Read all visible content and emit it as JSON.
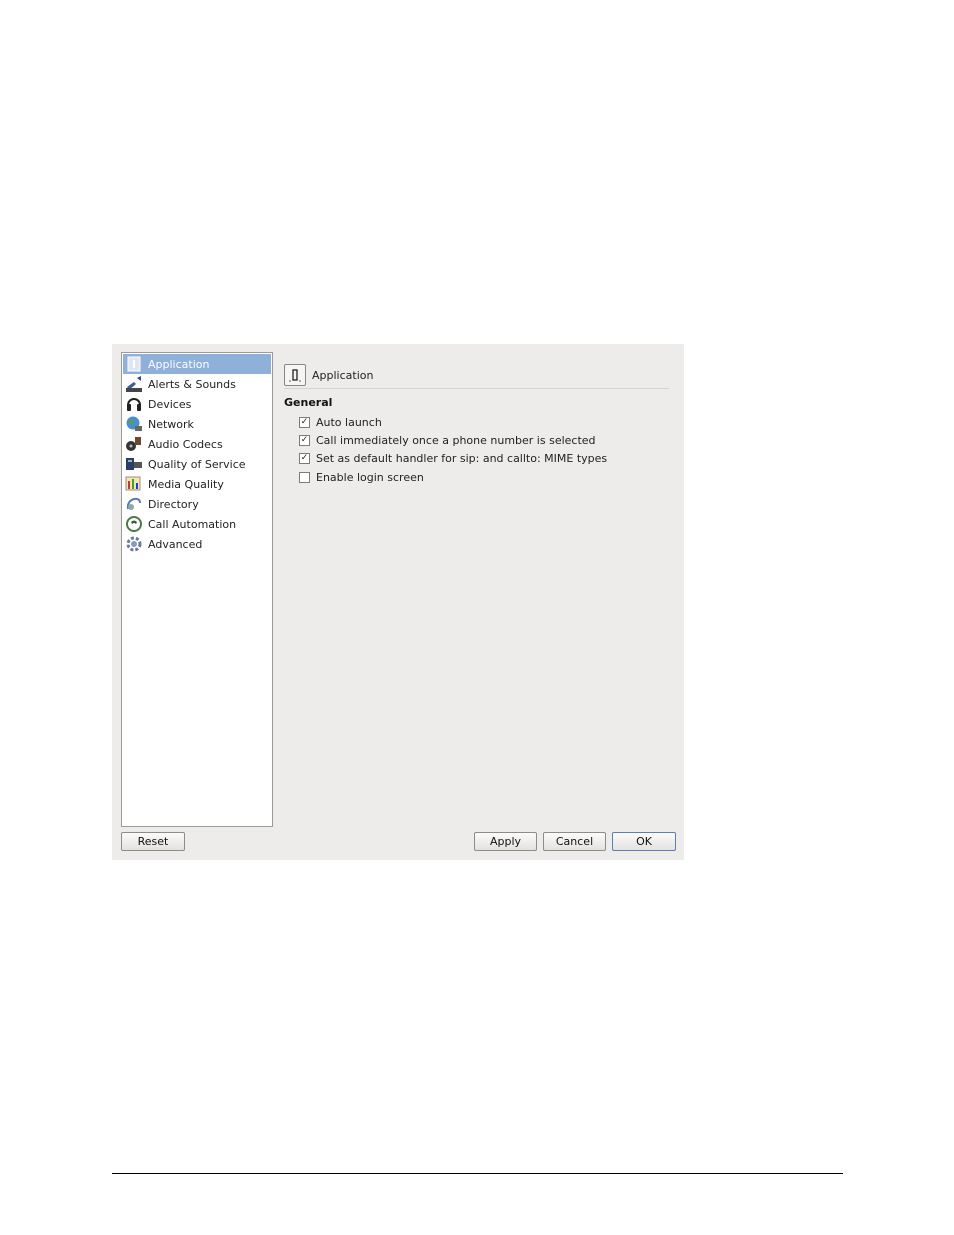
{
  "sidebar": {
    "items": [
      {
        "label": "Application",
        "icon": "application-icon",
        "selected": true
      },
      {
        "label": "Alerts & Sounds",
        "icon": "speaker-icon",
        "selected": false
      },
      {
        "label": "Devices",
        "icon": "headset-icon",
        "selected": false
      },
      {
        "label": "Network",
        "icon": "globe-icon",
        "selected": false
      },
      {
        "label": "Audio Codecs",
        "icon": "audio-codecs-icon",
        "selected": false
      },
      {
        "label": "Quality of Service",
        "icon": "quality-of-service-icon",
        "selected": false
      },
      {
        "label": "Media Quality",
        "icon": "media-quality-icon",
        "selected": false
      },
      {
        "label": "Directory",
        "icon": "directory-icon",
        "selected": false
      },
      {
        "label": "Call Automation",
        "icon": "call-automation-icon",
        "selected": false
      },
      {
        "label": "Advanced",
        "icon": "gear-icon",
        "selected": false
      }
    ]
  },
  "content": {
    "header_title": "Application",
    "section_title": "General",
    "options": [
      {
        "label": "Auto launch",
        "checked": true
      },
      {
        "label": "Call immediately once a phone number is selected",
        "checked": true
      },
      {
        "label": "Set as default handler for sip: and callto: MIME types",
        "checked": true
      },
      {
        "label": "Enable login screen",
        "checked": false
      }
    ]
  },
  "buttons": {
    "reset": "Reset",
    "apply": "Apply",
    "cancel": "Cancel",
    "ok": "OK"
  },
  "colors": {
    "selection": "#8fb0d9",
    "dialog_bg": "#edeceb"
  }
}
